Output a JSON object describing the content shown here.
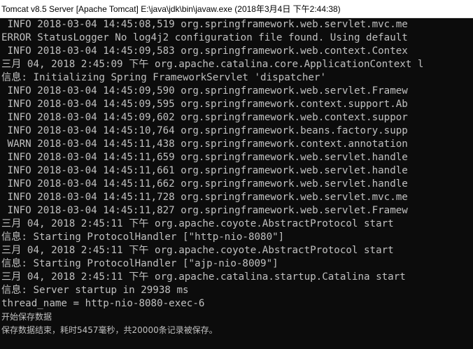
{
  "window": {
    "title": "Tomcat v8.5 Server [Apache Tomcat] E:\\java\\jdk\\bin\\javaw.exe (2018年3月4日 下午2:44:38)"
  },
  "colors": {
    "background": "#0c0c0c",
    "text": "#c0c0c0",
    "titlebar": "#ffffff"
  },
  "console": {
    "lines": [
      " INFO 2018-03-04 14:45:08,519 org.springframework.web.servlet.mvc.me",
      "ERROR StatusLogger No log4j2 configuration file found. Using default",
      " INFO 2018-03-04 14:45:09,583 org.springframework.web.context.Contex",
      "三月 04, 2018 2:45:09 下午 org.apache.catalina.core.ApplicationContext l",
      "信息: Initializing Spring FrameworkServlet 'dispatcher'",
      " INFO 2018-03-04 14:45:09,590 org.springframework.web.servlet.Framew",
      " INFO 2018-03-04 14:45:09,595 org.springframework.context.support.Ab",
      " INFO 2018-03-04 14:45:09,602 org.springframework.web.context.suppor",
      " INFO 2018-03-04 14:45:10,764 org.springframework.beans.factory.supp",
      " WARN 2018-03-04 14:45:11,438 org.springframework.context.annotation",
      " INFO 2018-03-04 14:45:11,659 org.springframework.web.servlet.handle",
      " INFO 2018-03-04 14:45:11,661 org.springframework.web.servlet.handle",
      " INFO 2018-03-04 14:45:11,662 org.springframework.web.servlet.handle",
      " INFO 2018-03-04 14:45:11,728 org.springframework.web.servlet.mvc.me",
      " INFO 2018-03-04 14:45:11,827 org.springframework.web.servlet.Framew",
      "三月 04, 2018 2:45:11 下午 org.apache.coyote.AbstractProtocol start",
      "信息: Starting ProtocolHandler [\"http-nio-8080\"]",
      "三月 04, 2018 2:45:11 下午 org.apache.coyote.AbstractProtocol start",
      "信息: Starting ProtocolHandler [\"ajp-nio-8009\"]",
      "三月 04, 2018 2:45:11 下午 org.apache.catalina.startup.Catalina start",
      "信息: Server startup in 29938 ms",
      "thread_name = http-nio-8080-exec-6",
      "开始保存数据",
      "保存数据结束，耗时5457毫秒，共20000条记录被保存。"
    ]
  }
}
